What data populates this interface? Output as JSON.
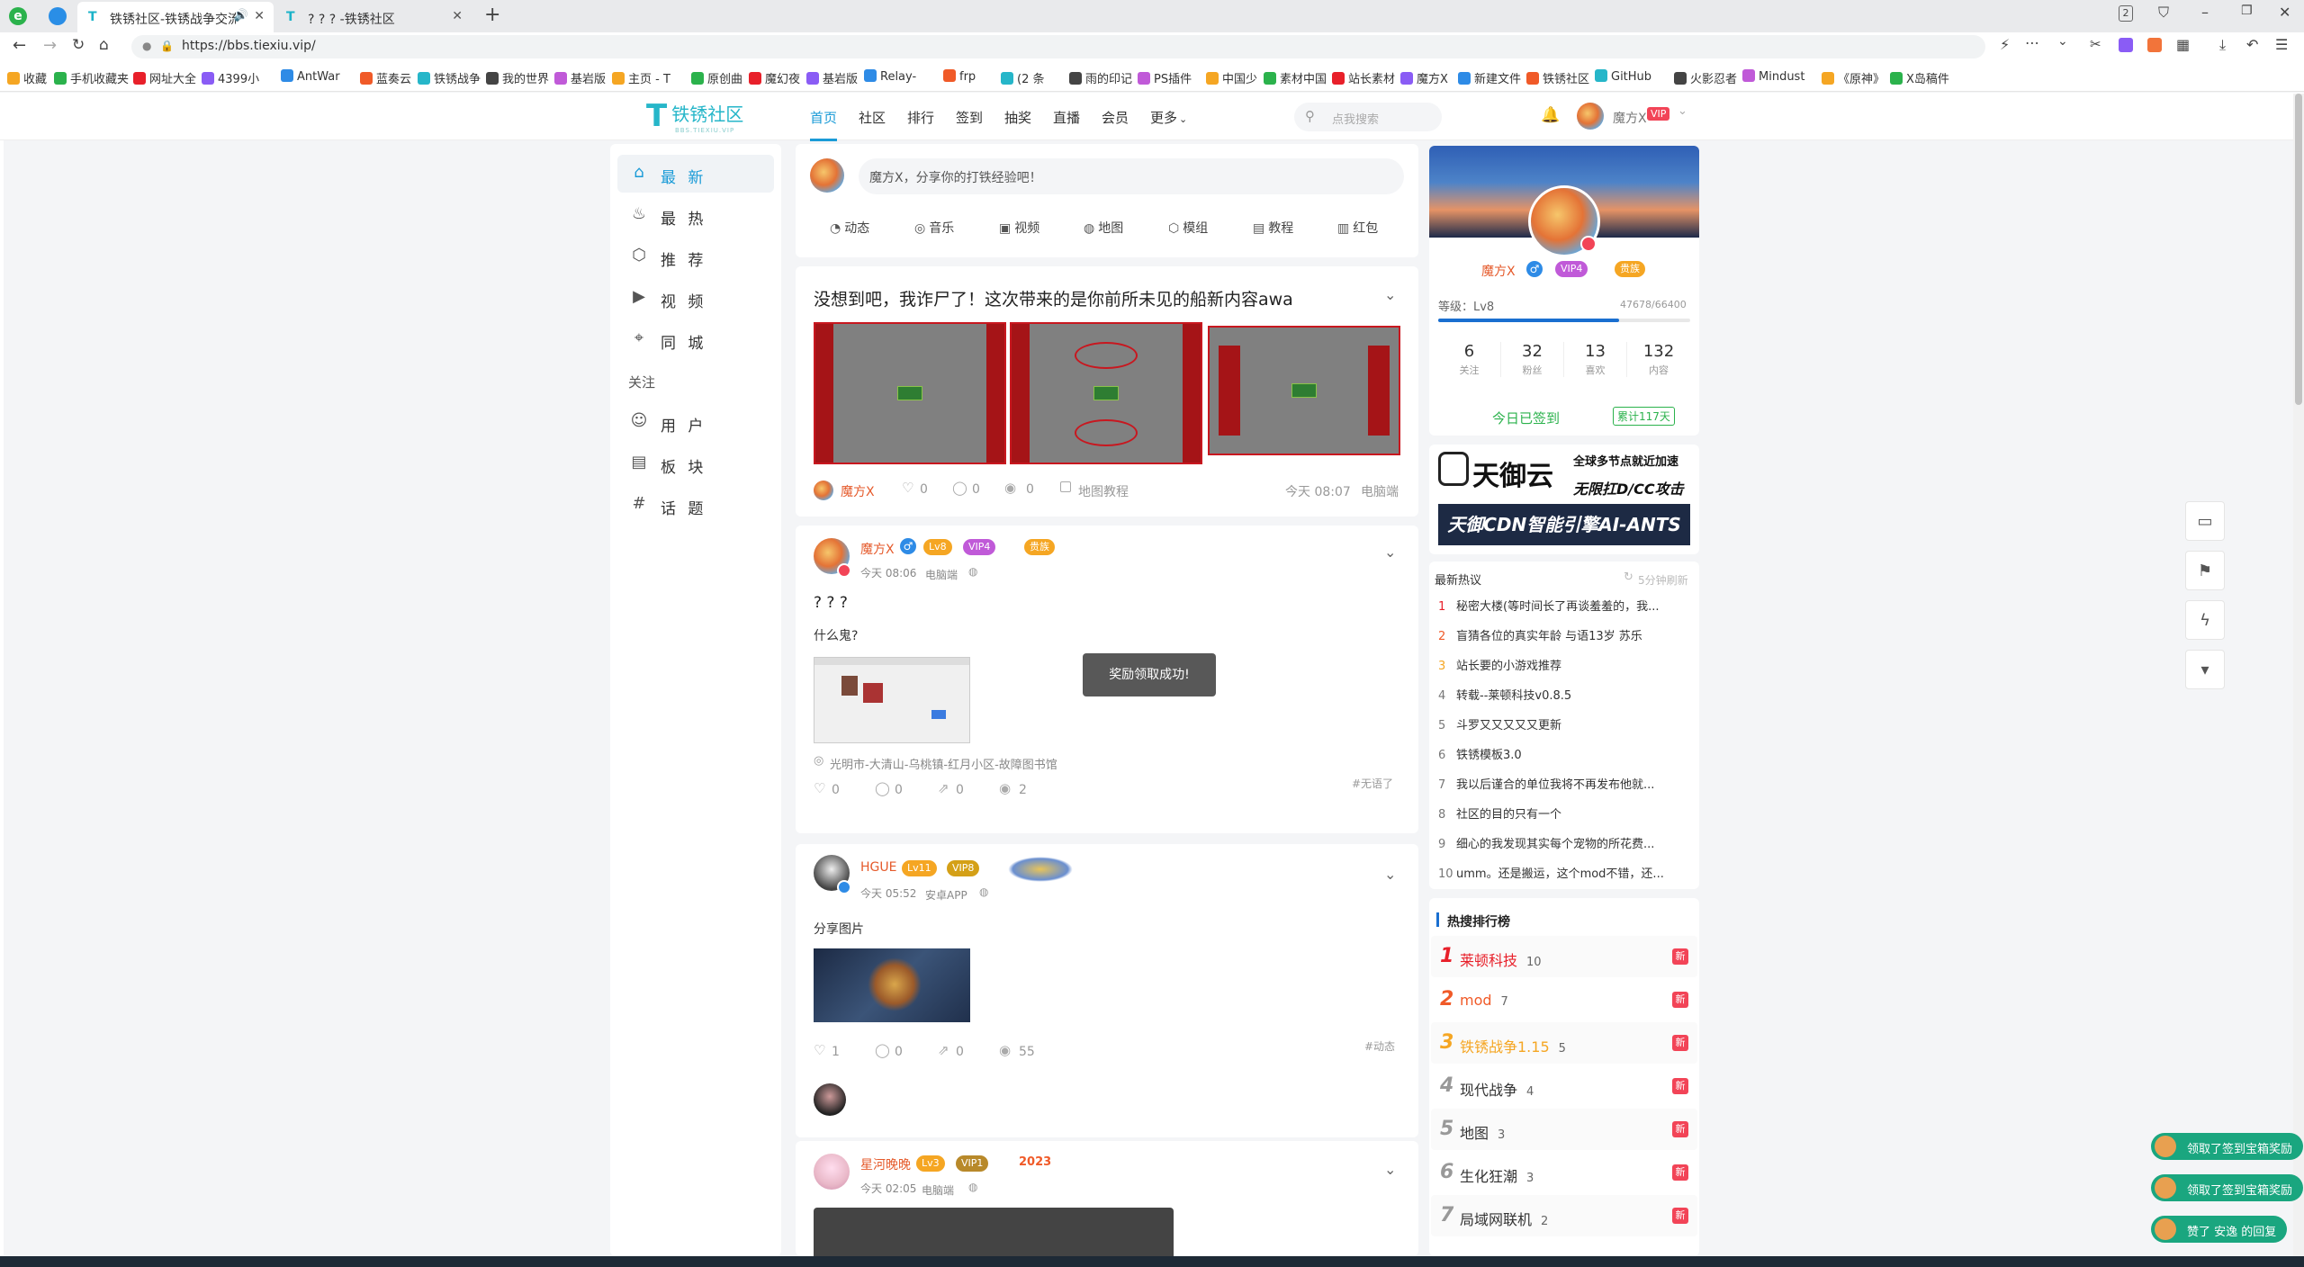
{
  "browser": {
    "tabs": [
      {
        "title": "铁锈社区-铁锈战争交流社区",
        "active": true
      },
      {
        "title": "? ? ? -铁锈社区",
        "active": false
      }
    ],
    "tab_count": "2",
    "url": "https://bbs.tiexiu.vip/"
  },
  "bookmarks": [
    "收藏",
    "手机收藏夹",
    "网址大全",
    "4399小",
    "AntWar",
    "蓝奏云",
    "铁锈战争",
    "我的世界",
    "基岩版",
    "主页 - T",
    "原创曲",
    "魔幻夜",
    "基岩版",
    "Relay-",
    "frp",
    "(2 条",
    "雨的印记",
    "PS插件",
    "中国少",
    "素材中国",
    "站长素材",
    "魔方X",
    "新建文件",
    "铁锈社区",
    "GitHub",
    "火影忍者",
    "Mindust",
    "《原神》",
    "X岛稿件"
  ],
  "site": {
    "logo": "铁锈社区",
    "logo_sub": "BBS.TIEXIU.VIP",
    "nav": [
      "首页",
      "社区",
      "排行",
      "签到",
      "抽奖",
      "直播",
      "会员",
      "更多"
    ],
    "search_placeholder": "点我搜索",
    "user": "魔方X",
    "user_badge": "VIP"
  },
  "left_nav": {
    "items": [
      {
        "label": "最 新",
        "icon": "home-icon",
        "active": true
      },
      {
        "label": "最 热",
        "icon": "fire-icon"
      },
      {
        "label": "推 荐",
        "icon": "recommend-icon"
      },
      {
        "label": "视 频",
        "icon": "video-icon"
      },
      {
        "label": "同 城",
        "icon": "location-icon"
      }
    ],
    "section": "关注",
    "follow_items": [
      {
        "label": "用 户",
        "icon": "user-icon"
      },
      {
        "label": "板 块",
        "icon": "board-icon"
      },
      {
        "label": "话 题",
        "icon": "topic-icon"
      }
    ]
  },
  "composer": {
    "placeholder": "魔方X，分享你的打铁经验吧！",
    "buttons": [
      "动态",
      "音乐",
      "视频",
      "地图",
      "模组",
      "教程",
      "红包"
    ]
  },
  "posts": [
    {
      "title": "没想到吧，我诈尸了！这次带来的是你前所未见的船新内容awa",
      "author": "魔方X",
      "likes": "0",
      "comments": "0",
      "views": "0",
      "tag": "地图教程",
      "time": "今天 08:07",
      "device": "电脑端"
    },
    {
      "author": "魔方X",
      "level": "Lv8",
      "vip": "VIP4",
      "extra": "贵族",
      "time": "今天 08:06",
      "device": "电脑端",
      "title": "? ? ?",
      "body": "什么鬼?",
      "location": "光明市-大清山-乌桃镇-红月小区-故障图书馆",
      "likes": "0",
      "comments": "0",
      "shares": "0",
      "views": "2",
      "tag": "#无语了"
    },
    {
      "author": "HGUE",
      "level": "Lv11",
      "vip": "VIP8",
      "time": "今天 05:52",
      "device": "安卓APP",
      "body": "分享图片",
      "likes": "1",
      "comments": "0",
      "shares": "0",
      "views": "55",
      "tag": "#动态"
    },
    {
      "author": "星河晚晚",
      "level": "Lv3",
      "vip": "VIP1",
      "extra": "2023",
      "time": "今天 02:05",
      "device": "电脑端"
    }
  ],
  "toast": "奖励领取成功!",
  "profile": {
    "name": "魔方X",
    "vip": "VIP4",
    "extra": "贵族",
    "level_label": "等级：Lv8",
    "exp": "47678/66400",
    "exp_ratio": 0.718,
    "stats": [
      {
        "value": "6",
        "label": "关注"
      },
      {
        "value": "32",
        "label": "粉丝"
      },
      {
        "value": "13",
        "label": "喜欢"
      },
      {
        "value": "132",
        "label": "内容"
      }
    ],
    "signed": "今日已签到",
    "streak": "累计117天"
  },
  "ad": {
    "brand": "天御云",
    "line1": "全球多节点就近加速",
    "line2": "无限扛D/CC攻击",
    "banner": "天御CDN智能引擎AI-ANTS"
  },
  "hot_topics": {
    "title": "最新热议",
    "refresh": "5分钟刷新",
    "items": [
      "秘密大楼(等时间长了再谈羞羞的，我...",
      "盲猜各位的真实年龄 与语13岁 苏乐",
      "站长要的小游戏推荐",
      "转载--莱顿科技v0.8.5",
      "斗罗又又又又又更新",
      "铁锈模板3.0",
      "我以后谨合的单位我将不再发布他就...",
      "社区的目的只有一个",
      "细心的我发现其实每个宠物的所花费...",
      "umm。还是搬运，这个mod不错，还..."
    ]
  },
  "hot_rank": {
    "title": "热搜排行榜",
    "items": [
      {
        "name": "莱顿科技",
        "count": "10",
        "color": "#e8202a"
      },
      {
        "name": "mod",
        "count": "7",
        "color": "#f05a28"
      },
      {
        "name": "铁锈战争1.15",
        "count": "5",
        "color": "#f5a623"
      },
      {
        "name": "现代战争",
        "count": "4",
        "color": "#999"
      },
      {
        "name": "地图",
        "count": "3",
        "color": "#999"
      },
      {
        "name": "生化狂潮",
        "count": "3",
        "color": "#999"
      },
      {
        "name": "局域网联机",
        "count": "2",
        "color": "#999"
      }
    ],
    "new_label": "新"
  },
  "notifications": [
    "领取了签到宝箱奖励",
    "领取了签到宝箱奖励",
    "赞了 安逸 的回复"
  ]
}
